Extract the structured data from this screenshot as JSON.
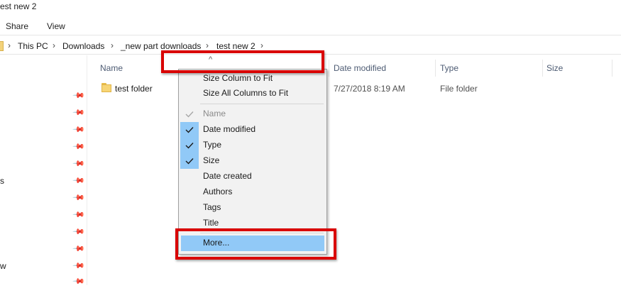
{
  "window": {
    "title": "est new 2"
  },
  "ribbon": {
    "tabs": [
      "Share",
      "View"
    ]
  },
  "breadcrumb": {
    "items": [
      "This PC",
      "Downloads",
      "_new part downloads",
      "test new 2"
    ]
  },
  "sidebar": {
    "partial_labels": [
      "s",
      "w"
    ]
  },
  "columns": {
    "name": "Name",
    "date_modified": "Date modified",
    "type": "Type",
    "size": "Size"
  },
  "files": [
    {
      "name": "test folder",
      "date_modified": "7/27/2018 8:19 AM",
      "type": "File folder",
      "size": ""
    }
  ],
  "context_menu": {
    "size_column_to_fit": "Size Column to Fit",
    "size_all_columns_to_fit": "Size All Columns to Fit",
    "columns": [
      {
        "label": "Name",
        "checked": true,
        "disabled": true
      },
      {
        "label": "Date modified",
        "checked": true,
        "disabled": false
      },
      {
        "label": "Type",
        "checked": true,
        "disabled": false
      },
      {
        "label": "Size",
        "checked": true,
        "disabled": false
      },
      {
        "label": "Date created",
        "checked": false,
        "disabled": false
      },
      {
        "label": "Authors",
        "checked": false,
        "disabled": false
      },
      {
        "label": "Tags",
        "checked": false,
        "disabled": false
      },
      {
        "label": "Title",
        "checked": false,
        "disabled": false
      }
    ],
    "more": "More..."
  },
  "colors": {
    "highlight": "#91c9f7",
    "annotation_red": "#d90000",
    "header_text": "#4d5b73"
  }
}
